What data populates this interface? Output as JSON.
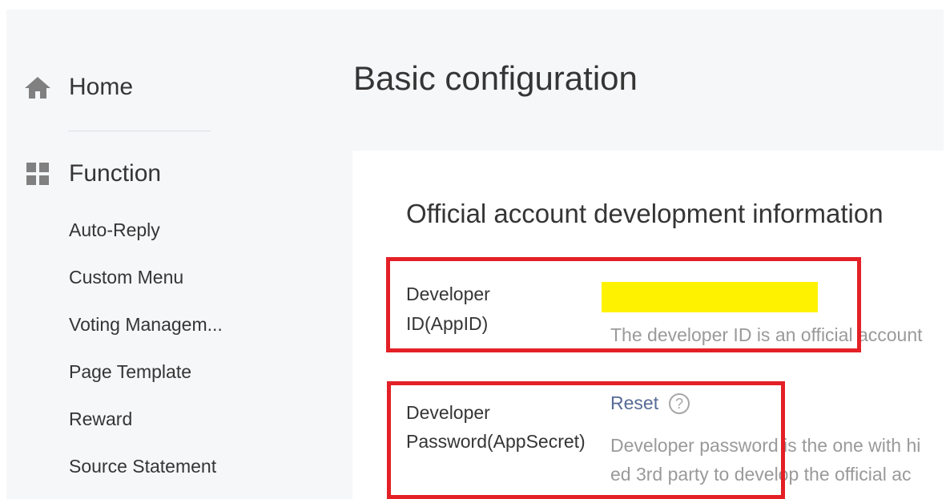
{
  "sidebar": {
    "home": {
      "label": "Home",
      "icon": "home-icon"
    },
    "function": {
      "label": "Function",
      "icon": "grid-icon"
    },
    "items": [
      {
        "label": "Auto-Reply"
      },
      {
        "label": "Custom Menu"
      },
      {
        "label": "Voting Managem..."
      },
      {
        "label": "Page Template"
      },
      {
        "label": "Reward"
      },
      {
        "label": "Source Statement"
      }
    ]
  },
  "main": {
    "title": "Basic configuration",
    "section_title": "Official account development information",
    "appid": {
      "label_line1": "Developer",
      "label_line2": "ID(AppID)",
      "redaction_color": "#fff200",
      "description": "The developer ID is an official account"
    },
    "appsecret": {
      "label_line1": "Developer",
      "label_line2": "Password(AppSecret)",
      "reset_label": "Reset",
      "help_symbol": "?",
      "description_line1": "Developer password is the one with hi",
      "description_line2": "ed 3rd party to develop the official ac"
    }
  },
  "colors": {
    "highlight": "#e32026",
    "link": "#576b95",
    "sidebar_bg": "#f6f7f9"
  }
}
